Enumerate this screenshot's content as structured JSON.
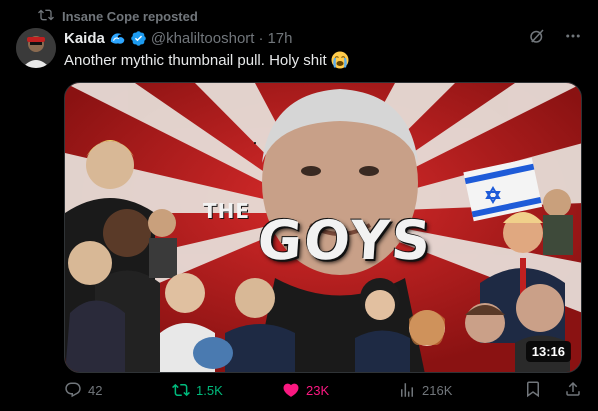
{
  "repost": {
    "label": "Insane Cope reposted"
  },
  "author": {
    "name": "Kaida",
    "handle": "@khaliltooshort",
    "time": "17h"
  },
  "post": {
    "text": "Another mythic thumbnail pull. Holy shit",
    "emoji": "loudly-crying-face"
  },
  "media": {
    "title": "GOYS",
    "title_prefix": "THE",
    "duration": "13:16",
    "type": "video-thumbnail"
  },
  "actions": {
    "replies": "42",
    "reposts": "1.5K",
    "likes": "23K",
    "views": "216K"
  },
  "colors": {
    "background": "#000000",
    "text": "#e7e9ea",
    "muted": "#71767b",
    "repost_active": "#00ba7c",
    "like_active": "#f91880",
    "verified": "#1d9bf0"
  }
}
